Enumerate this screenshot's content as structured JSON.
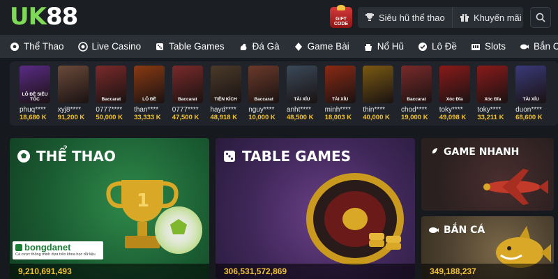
{
  "header": {
    "logo_uk": "UK",
    "logo_88": "88",
    "giftcode_line1": "GIFT",
    "giftcode_line2": "CODE",
    "jackpot_label": "Siêu hũ thể thao",
    "promo_label": "Khuyến mãi"
  },
  "nav": {
    "items": [
      {
        "label": "Thể Thao",
        "icon": "soccer-ball-icon"
      },
      {
        "label": "Live Casino",
        "icon": "casino-chip-icon"
      },
      {
        "label": "Table Games",
        "icon": "dice-icon"
      },
      {
        "label": "Đá Gà",
        "icon": "rooster-icon"
      },
      {
        "label": "Game Bài",
        "icon": "cards-icon"
      },
      {
        "label": "Nổ Hũ",
        "icon": "jackpot-icon"
      },
      {
        "label": "Lô Đề",
        "icon": "lottery-icon"
      },
      {
        "label": "Slots",
        "icon": "slot-machine-icon"
      },
      {
        "label": "Bắn Cá",
        "icon": "fish-icon"
      }
    ]
  },
  "winners": [
    {
      "name": "phuq****",
      "amount": "18,680 K",
      "caption": "LÔ ĐỀ SIÊU TỐC",
      "color": "#5a2b86"
    },
    {
      "name": "xyj8****",
      "amount": "91,200 K",
      "caption": "",
      "color": "#6b4a3a"
    },
    {
      "name": "0777****",
      "amount": "50,000 K",
      "caption": "Baccarat",
      "color": "#7a2a2a"
    },
    {
      "name": "than****",
      "amount": "33,333 K",
      "caption": "LÔ ĐỀ",
      "color": "#8a3a12"
    },
    {
      "name": "0777****",
      "amount": "47,500 K",
      "caption": "Baccarat",
      "color": "#7a2a2a"
    },
    {
      "name": "hayd****",
      "amount": "48,918 K",
      "caption": "TIỆN KÍCH",
      "color": "#4a3a2a"
    },
    {
      "name": "nguy****",
      "amount": "10,000 K",
      "caption": "Baccarat",
      "color": "#6b3a2a"
    },
    {
      "name": "anht****",
      "amount": "48,500 K",
      "caption": "TÀI XỈU",
      "color": "#3a4a5a"
    },
    {
      "name": "minh****",
      "amount": "18,003 K",
      "caption": "TÀI XỈU",
      "color": "#8a2a14"
    },
    {
      "name": "thin****",
      "amount": "40,000 K",
      "caption": "",
      "color": "#7a5a12"
    },
    {
      "name": "chod****",
      "amount": "19,000 K",
      "caption": "Baccarat",
      "color": "#7a2a2a"
    },
    {
      "name": "toky****",
      "amount": "49,098 K",
      "caption": "Xóc Đĩa",
      "color": "#8a1a1a"
    },
    {
      "name": "toky****",
      "amount": "33,211 K",
      "caption": "Xóc Đĩa",
      "color": "#8a1a1a"
    },
    {
      "name": "duon****",
      "amount": "68,600 K",
      "caption": "TÀI XỈU",
      "color": "#3a3a7a"
    }
  ],
  "cards": {
    "sport": {
      "title": "THỂ THAO",
      "count": "9,210,691,493"
    },
    "table": {
      "title": "TABLE GAMES",
      "count": "306,531,572,869"
    },
    "fast": {
      "title": "GAME NHANH"
    },
    "fish": {
      "title": "BẮN CÁ",
      "count": "349,188,237"
    }
  },
  "bongdanet": {
    "name": "bongdanet",
    "tagline": "Cá cược thông minh dựa trên khoa học dữ liệu"
  },
  "colors": {
    "accent_green": "#7ed957",
    "amount_gold": "#f2c230",
    "nav_bg": "#2b3036",
    "header_bg": "#1b1f24"
  }
}
